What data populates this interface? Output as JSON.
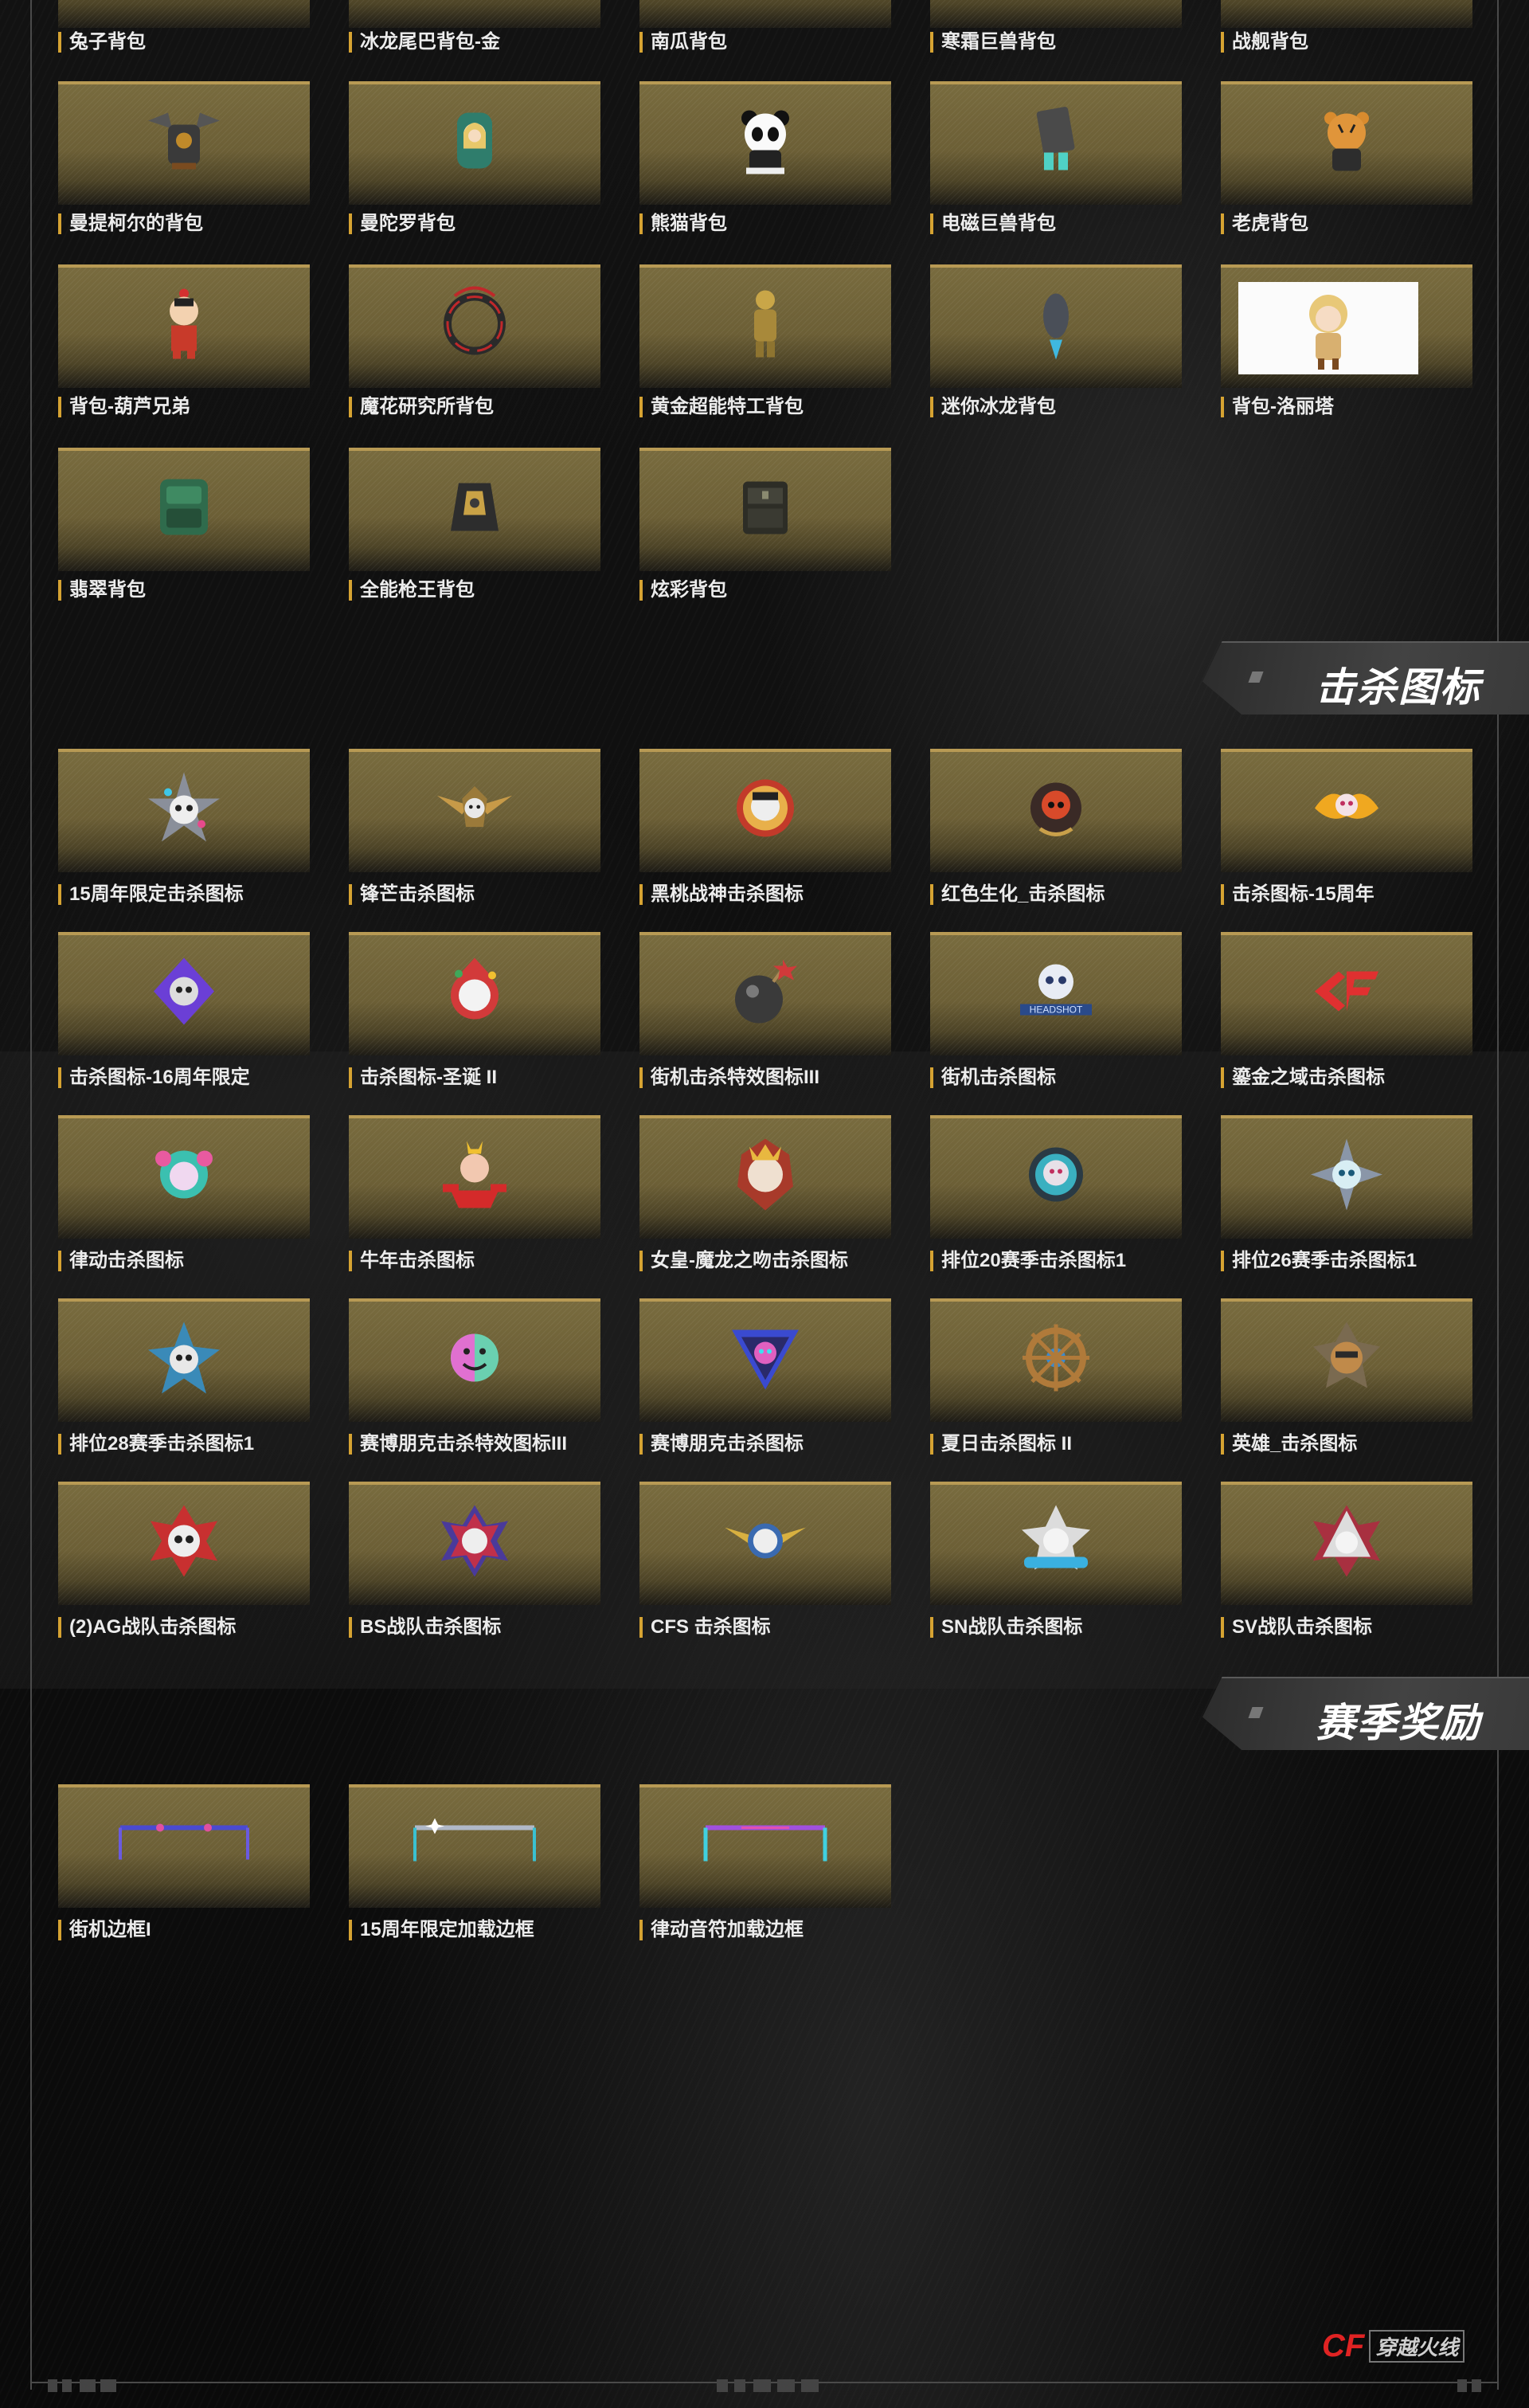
{
  "colors": {
    "accent": "#d6a332",
    "panel": "#786b3e",
    "brand_red": "#e02323"
  },
  "backpacks": {
    "items": [
      {
        "label": "兔子背包",
        "icon": "rabbit-backpack-icon"
      },
      {
        "label": "冰龙尾巴背包-金",
        "icon": "ice-dragon-tail-backpack-icon"
      },
      {
        "label": "南瓜背包",
        "icon": "pumpkin-backpack-icon"
      },
      {
        "label": "寒霜巨兽背包",
        "icon": "frost-beast-backpack-icon"
      },
      {
        "label": "战舰背包",
        "icon": "warship-backpack-icon"
      },
      {
        "label": "曼提柯尔的背包",
        "icon": "manticore-backpack-icon"
      },
      {
        "label": "曼陀罗背包",
        "icon": "mandala-backpack-icon"
      },
      {
        "label": "熊猫背包",
        "icon": "panda-backpack-icon"
      },
      {
        "label": "电磁巨兽背包",
        "icon": "em-beast-backpack-icon"
      },
      {
        "label": "老虎背包",
        "icon": "tiger-backpack-icon"
      },
      {
        "label": "背包-葫芦兄弟",
        "icon": "calabash-brother-backpack-icon"
      },
      {
        "label": "魔花研究所背包",
        "icon": "magic-flower-backpack-icon"
      },
      {
        "label": "黄金超能特工背包",
        "icon": "golden-agent-backpack-icon"
      },
      {
        "label": "迷你冰龙背包",
        "icon": "mini-ice-dragon-backpack-icon"
      },
      {
        "label": "背包-洛丽塔",
        "icon": "lolita-backpack-icon"
      },
      {
        "label": "翡翠背包",
        "icon": "jade-backpack-icon"
      },
      {
        "label": "全能枪王背包",
        "icon": "gun-king-backpack-icon"
      },
      {
        "label": "炫彩背包",
        "icon": "colorful-backpack-icon"
      }
    ]
  },
  "kill_icons": {
    "title": "击杀图标",
    "items": [
      {
        "label": "15周年限定击杀图标",
        "icon": "skull-star-emblem-icon"
      },
      {
        "label": "锋芒击杀图标",
        "icon": "winged-skull-emblem-icon"
      },
      {
        "label": "黑桃战神击杀图标",
        "icon": "spade-warrior-emblem-icon"
      },
      {
        "label": "红色生化_击杀图标",
        "icon": "red-biohazard-emblem-icon"
      },
      {
        "label": "击杀图标-15周年",
        "icon": "phoenix-emblem-icon"
      },
      {
        "label": "击杀图标-16周年限定",
        "icon": "purple-skull-emblem-icon"
      },
      {
        "label": "击杀图标-圣诞 II",
        "icon": "santa-emblem-icon"
      },
      {
        "label": "街机击杀特效图标III",
        "icon": "bomb-emblem-icon"
      },
      {
        "label": "街机击杀图标",
        "icon": "headshot-skull-emblem-icon"
      },
      {
        "label": "鎏金之域击杀图标",
        "icon": "cf-logo-emblem-icon"
      },
      {
        "label": "律动击杀图标",
        "icon": "rhythm-emblem-icon"
      },
      {
        "label": "牛年击杀图标",
        "icon": "ox-year-emblem-icon"
      },
      {
        "label": "女皇-魔龙之吻击杀图标",
        "icon": "empress-dragon-emblem-icon"
      },
      {
        "label": "排位20赛季击杀图标1",
        "icon": "ranked-s20-emblem-icon"
      },
      {
        "label": "排位26赛季击杀图标1",
        "icon": "ranked-s26-emblem-icon"
      },
      {
        "label": "排位28赛季击杀图标1",
        "icon": "ranked-s28-emblem-icon"
      },
      {
        "label": "赛博朋克击杀特效图标III",
        "icon": "cyber-smiley-emblem-icon"
      },
      {
        "label": "赛博朋克击杀图标",
        "icon": "cyber-triangle-emblem-icon"
      },
      {
        "label": "夏日击杀图标 II",
        "icon": "ship-wheel-emblem-icon"
      },
      {
        "label": "英雄_击杀图标",
        "icon": "hero-emblem-icon"
      },
      {
        "label": "(2)AG战队击杀图标",
        "icon": "ag-team-skull-icon"
      },
      {
        "label": "BS战队击杀图标",
        "icon": "bs-team-skull-icon"
      },
      {
        "label": "CFS 击杀图标",
        "icon": "cfs-winged-skull-icon"
      },
      {
        "label": "SN战队击杀图标",
        "icon": "sn-team-skull-icon"
      },
      {
        "label": "SV战队击杀图标",
        "icon": "sv-team-skull-icon"
      }
    ]
  },
  "season_rewards": {
    "title": "赛季奖励",
    "items": [
      {
        "label": "街机边框I",
        "icon": "arcade-frame-icon"
      },
      {
        "label": "15周年限定加载边框",
        "icon": "anniversary-frame-icon"
      },
      {
        "label": "律动音符加载边框",
        "icon": "rhythm-note-frame-icon"
      }
    ]
  },
  "footer": {
    "logo_cf": "CF",
    "logo_name": "穿越火线"
  }
}
